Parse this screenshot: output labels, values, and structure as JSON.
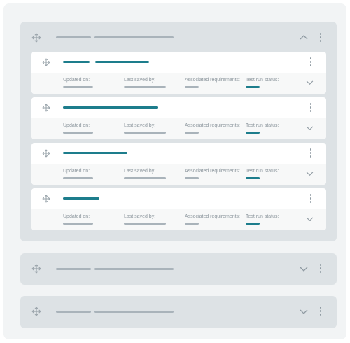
{
  "icons": {
    "move": "move-arrows-icon",
    "collapse": "chevron-up-icon",
    "expand": "chevron-down-icon",
    "menu": "more-vertical-icon"
  },
  "colors": {
    "accent": "#1d7d8c",
    "placeholder": "#a9b3ba",
    "group_bg": "#dde2e5",
    "canvas_bg": "#f2f4f5"
  },
  "groups": [
    {
      "state": "expanded",
      "chevron": "chevron-up-icon"
    },
    {
      "state": "collapsed",
      "chevron": "chevron-down-icon"
    },
    {
      "state": "collapsed",
      "chevron": "chevron-down-icon"
    }
  ],
  "cards": [
    {
      "labels": {
        "updated_on": "Updated on:",
        "last_saved_by": "Last saved by:",
        "associated_requirements": "Associated requirements:",
        "test_run_status": "Test run status:"
      }
    },
    {
      "labels": {
        "updated_on": "Updated on:",
        "last_saved_by": "Last saved by:",
        "associated_requirements": "Associated requirements:",
        "test_run_status": "Test run status:"
      }
    },
    {
      "labels": {
        "updated_on": "Updated on:",
        "last_saved_by": "Last saved by:",
        "associated_requirements": "Associated requirements:",
        "test_run_status": "Test run status:"
      }
    },
    {
      "labels": {
        "updated_on": "Updated on:",
        "last_saved_by": "Last saved by:",
        "associated_requirements": "Associated requirements:",
        "test_run_status": "Test run status:"
      }
    }
  ]
}
